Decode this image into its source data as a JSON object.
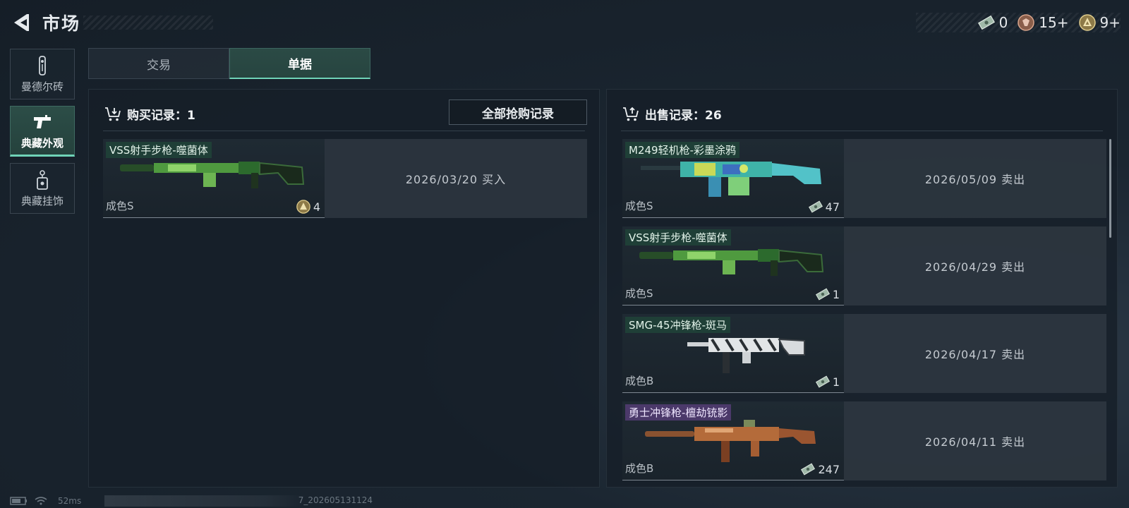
{
  "header": {
    "title": "市场",
    "currencies": [
      {
        "icon": "banknote-icon",
        "value": "0"
      },
      {
        "icon": "bronze-token-icon",
        "value": "15+"
      },
      {
        "icon": "gold-coin-icon",
        "value": "9+"
      }
    ]
  },
  "sidebar": {
    "items": [
      {
        "label": "曼德尔砖",
        "icon": "mandel-brick-icon",
        "active": false
      },
      {
        "label": "典藏外观",
        "icon": "pistol-icon",
        "active": true
      },
      {
        "label": "典藏挂饰",
        "icon": "charm-tag-icon",
        "active": false
      }
    ]
  },
  "tabs": [
    {
      "label": "交易",
      "active": false
    },
    {
      "label": "单据",
      "active": true
    }
  ],
  "purchase": {
    "title": "购买记录：1",
    "all_button": "全部抢购记录",
    "records": [
      {
        "name": "VSS射手步枪-噬菌体",
        "grade": "成色S",
        "price": "4",
        "currency_icon": "gold-coin-icon",
        "date": "2026/03/20 买入",
        "skin": "green"
      }
    ]
  },
  "sales": {
    "title": "出售记录：26",
    "records": [
      {
        "name": "M249轻机枪-彩墨涂鸦",
        "grade": "成色S",
        "price": "47",
        "currency_icon": "banknote-icon",
        "date": "2026/05/09 卖出",
        "skin": "teal"
      },
      {
        "name": "VSS射手步枪-噬菌体",
        "grade": "成色S",
        "price": "1",
        "currency_icon": "banknote-icon",
        "date": "2026/04/29 卖出",
        "skin": "green"
      },
      {
        "name": "SMG-45冲锋枪-斑马",
        "grade": "成色B",
        "price": "1",
        "currency_icon": "banknote-icon",
        "date": "2026/04/17 卖出",
        "skin": "zebra"
      },
      {
        "name": "勇士冲锋枪-檀劫铳影",
        "grade": "成色B",
        "price": "247",
        "currency_icon": "banknote-icon",
        "date": "2026/04/11 卖出",
        "skin": "bronze"
      }
    ]
  },
  "status": {
    "latency": "52ms",
    "build": "7_202605131124"
  },
  "colors": {
    "accent": "#6fd3b7",
    "active_tab_bg": "#2b4a45",
    "panel_bg": "#161f28",
    "purple_tag": "#4e3a6e"
  }
}
